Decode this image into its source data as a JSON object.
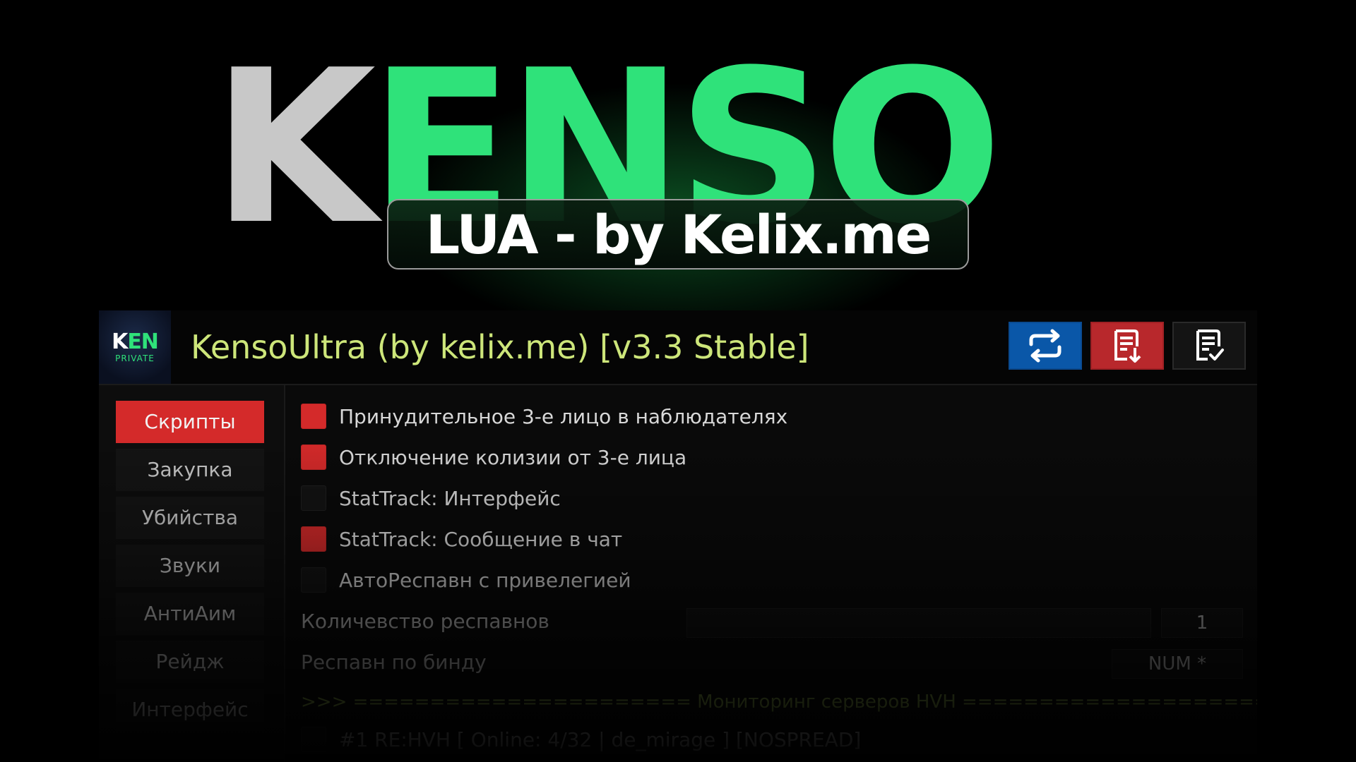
{
  "banner": {
    "title_first": "K",
    "title_rest": "ENSO",
    "subtitle": "LUA - by Kelix.me"
  },
  "window": {
    "logo": {
      "word_first": "K",
      "word_rest": "EN",
      "sub": "PRIVATE"
    },
    "title": "KensoUltra (by kelix.me) [v3.3 Stable]",
    "buttons": [
      {
        "icon": "refresh-icon",
        "color": "#0a57a8"
      },
      {
        "icon": "download-list-icon",
        "color": "#b8282c"
      },
      {
        "icon": "checklist-icon",
        "color": "#141414"
      }
    ]
  },
  "sidebar": {
    "items": [
      {
        "label": "Скрипты",
        "active": true
      },
      {
        "label": "Закупка",
        "active": false
      },
      {
        "label": "Убийства",
        "active": false
      },
      {
        "label": "Звуки",
        "active": false
      },
      {
        "label": "АнтиАим",
        "active": false
      },
      {
        "label": "Рейдж",
        "active": false
      },
      {
        "label": "Интерфейс",
        "active": false
      }
    ]
  },
  "content": {
    "options": [
      {
        "label": "Принудительное 3-е лицо в наблюдателях",
        "checked": true
      },
      {
        "label": "Отключение колизии от 3-е лица",
        "checked": true
      },
      {
        "label": "StatTrack: Интерфейс",
        "checked": false
      },
      {
        "label": "StatTrack: Сообщение в чат",
        "checked": true
      },
      {
        "label": "АвтоРеспавн с привелегией",
        "checked": false
      }
    ],
    "respawn_count": {
      "label": "Количевство респавнов",
      "value": "1"
    },
    "respawn_bind": {
      "label": "Респавн по бинду",
      "value": "NUM *"
    },
    "monitor_header": ">>> ====================== Мониторинг серверов HVH ============================= <<<",
    "server_row": "#1 RE:HVH [ Online: 4/32 | de_mirage ] [NOSPREAD]"
  },
  "colors": {
    "accent_green": "#2fe27a",
    "accent_red": "#d42a2a",
    "title_yellow": "#cde67a"
  }
}
